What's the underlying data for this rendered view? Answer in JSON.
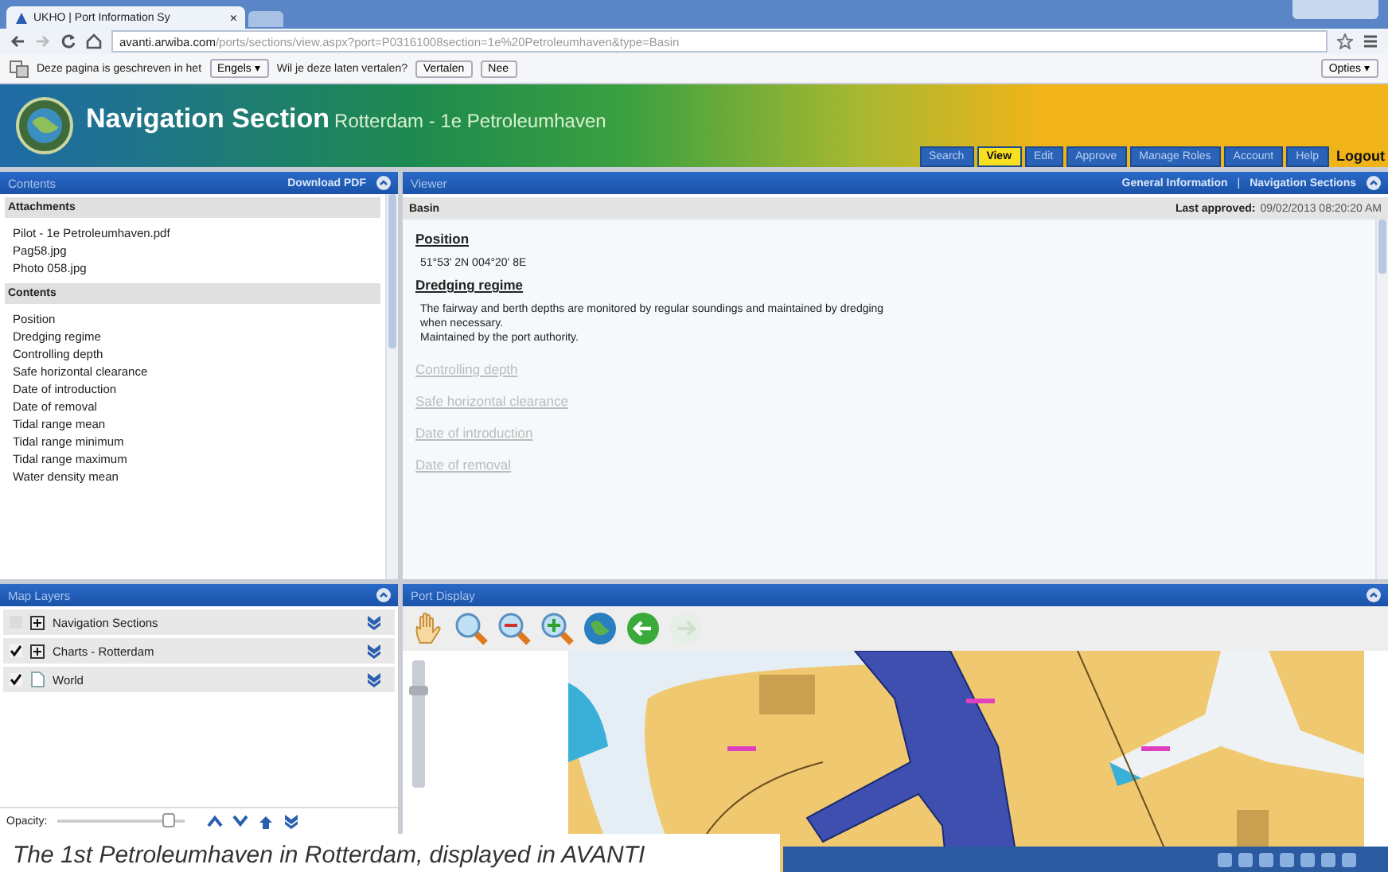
{
  "browser": {
    "tab_title": "UKHO | Port Information Sy",
    "tab_close": "×",
    "url_host": "avanti.arwiba.com",
    "url_path": "/ports/sections/view.aspx?port=P03161008section=1e%20Petroleumhaven&type=Basin"
  },
  "translate_bar": {
    "message": "Deze pagina is geschreven in het",
    "language": "Engels ▾",
    "question": "Wil je deze laten vertalen?",
    "buttons": [
      "Vertalen",
      "Nee"
    ],
    "options": "Opties ▾"
  },
  "header": {
    "title": "Navigation Section",
    "subtitle": "Rotterdam - 1e Petroleumhaven",
    "nav": [
      {
        "label": "Search",
        "selected": false
      },
      {
        "label": "View",
        "selected": true
      },
      {
        "label": "Edit",
        "selected": false
      },
      {
        "label": "Approve",
        "selected": false
      },
      {
        "label": "Manage Roles",
        "selected": false
      },
      {
        "label": "Account",
        "selected": false
      },
      {
        "label": "Help",
        "selected": false
      }
    ],
    "logout": "Logout"
  },
  "contents_panel": {
    "title": "Contents",
    "action": "Download PDF",
    "sections": [
      {
        "title": "Attachments",
        "items": [
          "Pilot - 1e Petroleumhaven.pdf",
          "Pag58.jpg",
          "Photo 058.jpg"
        ]
      },
      {
        "title": "Contents",
        "items": [
          "Position",
          "Dredging regime",
          "Controlling depth",
          "Safe horizontal clearance",
          "Date of introduction",
          "Date of removal",
          "Tidal range mean",
          "Tidal range minimum",
          "Tidal range maximum",
          "Water density mean"
        ]
      }
    ]
  },
  "viewer": {
    "title": "Viewer",
    "links": [
      "General Information",
      "|",
      "Navigation Sections"
    ],
    "record": "Basin",
    "approved_label": "Last approved:",
    "approved_value": "09/02/2013 08:20:20 AM",
    "blocks": [
      {
        "heading": "Position",
        "kind": "filled",
        "lines": [
          "51°53' 2N 004°20' 8E"
        ]
      },
      {
        "heading": "Dredging regime",
        "kind": "filled",
        "lines": [
          "The fairway and berth depths are monitored by regular soundings and maintained by dredging",
          "when necessary.",
          "Maintained by the port authority."
        ]
      },
      {
        "heading": "Controlling depth",
        "kind": "empty"
      },
      {
        "heading": "Safe horizontal clearance",
        "kind": "empty"
      },
      {
        "heading": "Date of introduction",
        "kind": "empty"
      },
      {
        "heading": "Date of removal",
        "kind": "empty"
      }
    ]
  },
  "map_layers": {
    "title": "Map Layers",
    "layers": [
      {
        "name": "Navigation Sections",
        "checked": false,
        "kind": "group"
      },
      {
        "name": "Charts - Rotterdam",
        "checked": true,
        "kind": "group"
      },
      {
        "name": "World",
        "checked": true,
        "kind": "layer"
      }
    ],
    "opacity_label": "Opacity:",
    "opacity": {
      "level": 0.88
    }
  },
  "port_display": {
    "title": "Port Display",
    "zoom": {
      "level": 0.8
    }
  },
  "caption": "The 1st Petroleumhaven in Rotterdam, displayed in AVANTI"
}
